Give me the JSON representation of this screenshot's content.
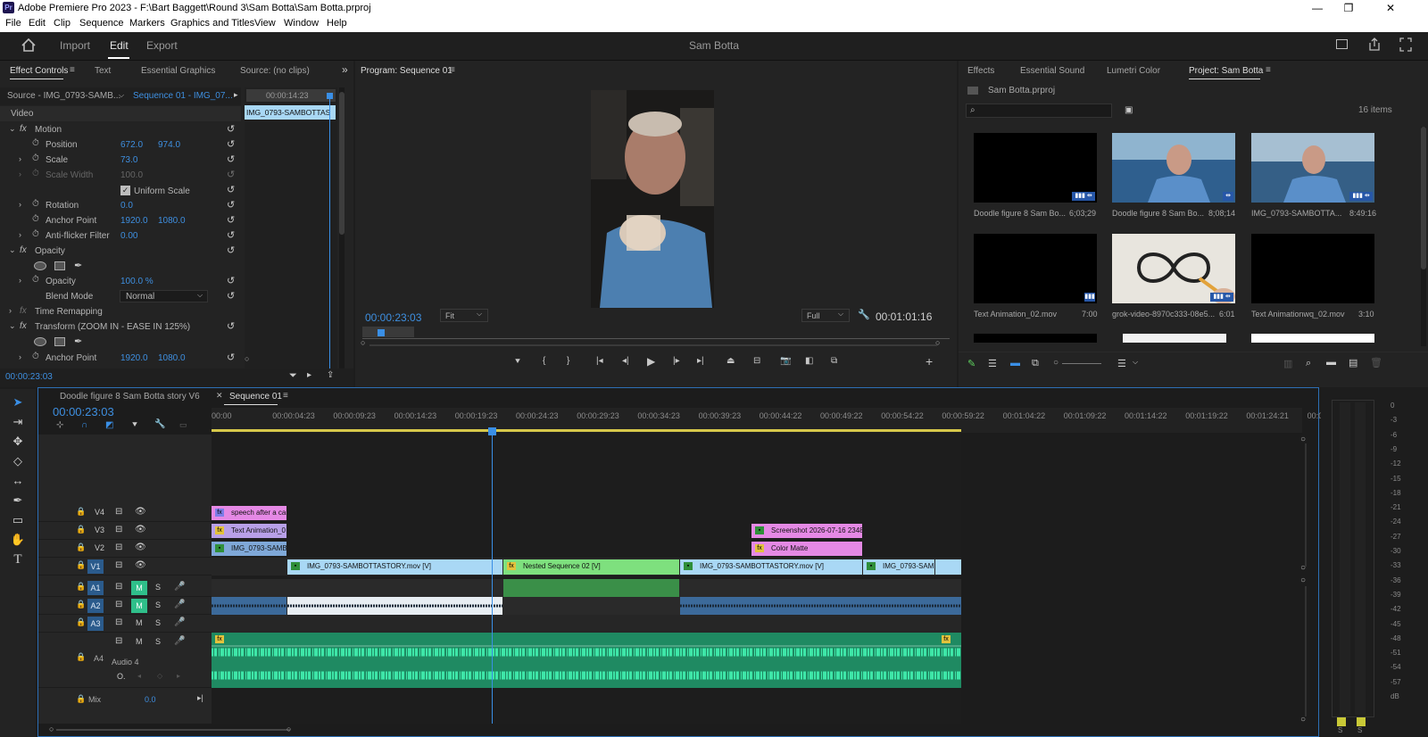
{
  "titlebar": {
    "text": "Adobe Premiere Pro 2023 - F:\\Bart Baggett\\Round 3\\Sam Botta\\Sam Botta.prproj",
    "minimize": "—",
    "maximize": "❐",
    "close": "✕"
  },
  "menu": [
    "File",
    "Edit",
    "Clip",
    "Sequence",
    "Markers",
    "Graphics and Titles",
    "View",
    "Window",
    "Help"
  ],
  "workspace": {
    "tabs": [
      "Import",
      "Edit",
      "Export"
    ],
    "active": "Edit",
    "title": "Sam Botta"
  },
  "effect_controls": {
    "tabs": [
      "Effect Controls",
      "Text",
      "Essential Graphics",
      "Source: (no clips)"
    ],
    "source": "Source - IMG_0793-SAMB...",
    "sequence": "Sequence 01 - IMG_07...",
    "mini_tc": "00:00:14:23",
    "mini_clip": "IMG_0793-SAMBOTTAS",
    "video_label": "Video",
    "motion": "Motion",
    "position": {
      "label": "Position",
      "x": "672.0",
      "y": "974.0"
    },
    "scale": {
      "label": "Scale",
      "v": "73.0"
    },
    "scale_width": {
      "label": "Scale Width",
      "v": "100.0"
    },
    "uniform": "Uniform Scale",
    "rotation": {
      "label": "Rotation",
      "v": "0.0"
    },
    "anchor": {
      "label": "Anchor Point",
      "x": "1920.0",
      "y": "1080.0"
    },
    "antiflicker": {
      "label": "Anti-flicker Filter",
      "v": "0.00"
    },
    "opacity_sec": "Opacity",
    "opacity": {
      "label": "Opacity",
      "v": "100.0 %"
    },
    "blend": {
      "label": "Blend Mode",
      "v": "Normal"
    },
    "time_remap": "Time Remapping",
    "transform": "Transform (ZOOM IN - EASE IN   125%)",
    "anchor2": {
      "label": "Anchor Point",
      "x": "1920.0",
      "y": "1080.0"
    },
    "footer_tc": "00:00:23:03"
  },
  "program": {
    "title": "Program: Sequence 01",
    "tc": "00:00:23:03",
    "fit": "Fit",
    "quality": "Full",
    "duration": "00:01:01:16"
  },
  "project": {
    "tabs": [
      "Effects",
      "Essential Sound",
      "Lumetri Color",
      "Project: Sam Botta"
    ],
    "file": "Sam Botta.prproj",
    "count": "16 items",
    "items": [
      {
        "name": "Doodle figure 8 Sam Bo...",
        "dur": "6;03;29"
      },
      {
        "name": "Doodle figure 8 Sam Bo...",
        "dur": "8;08;14"
      },
      {
        "name": "IMG_0793-SAMBOTTA...",
        "dur": "8:49:16"
      },
      {
        "name": "Text Animation_02.mov",
        "dur": "7:00"
      },
      {
        "name": "grok-video-8970c333-08e5...",
        "dur": "6:01"
      },
      {
        "name": "Text Animationwq_02.mov",
        "dur": "3:10"
      }
    ]
  },
  "timeline": {
    "tabs": [
      "Doodle figure 8 Sam Botta story V6",
      "Sequence 01"
    ],
    "tc": "00:00:23:03",
    "ruler": [
      "00:00",
      "00:00:04:23",
      "00:00:09:23",
      "00:00:14:23",
      "00:00:19:23",
      "00:00:24:23",
      "00:00:29:23",
      "00:00:34:23",
      "00:00:39:23",
      "00:00:44:22",
      "00:00:49:22",
      "00:00:54:22",
      "00:00:59:22",
      "00:01:04:22",
      "00:01:09:22",
      "00:01:14:22",
      "00:01:19:22",
      "00:01:24:21",
      "00:0"
    ],
    "tracks_v": [
      "V4",
      "V3",
      "V2",
      "V1"
    ],
    "tracks_a": [
      "A1",
      "A2",
      "A3",
      "A4"
    ],
    "a4_name": "Audio 4",
    "mix": "Mix",
    "mix_val": "0.0",
    "clips": {
      "v4": "speech after a car",
      "v3a": "Text Animation_0",
      "v3b": "Screenshot 2026-07-16 23482",
      "v2a": "IMG_0793-SAMB",
      "v2b": "Color Matte",
      "v1a": "IMG_0793-SAMBOTTASTORY.mov [V]",
      "v1b": "Nested Sequence 02 [V]",
      "v1c": "IMG_0793-SAMBOTTASTORY.mov [V]",
      "v1d": "IMG_0793-SAM"
    },
    "btn_m": "M",
    "btn_s": "S"
  },
  "meter": [
    "0",
    "-3",
    "-6",
    "-9",
    "-12",
    "-15",
    "-18",
    "-21",
    "-24",
    "-27",
    "-30",
    "-33",
    "-36",
    "-39",
    "-42",
    "-45",
    "-48",
    "-51",
    "-54",
    "-57",
    "dB"
  ],
  "meter_ss": [
    "S",
    "S"
  ],
  "colors": {
    "accent": "#2d8ceb",
    "v_clip": "#a9d8f5",
    "nested": "#7ee07e",
    "pink": "#e589e5",
    "audio": "#2fc28a"
  }
}
